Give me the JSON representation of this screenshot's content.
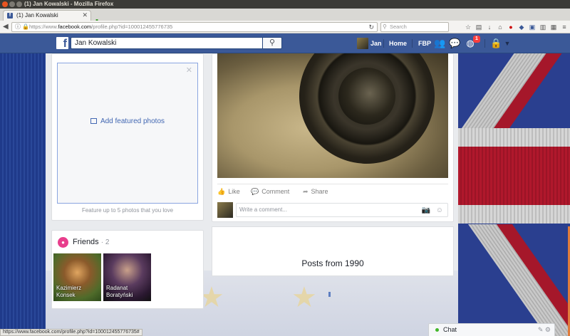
{
  "window": {
    "title": "(1) Jan Kowalski - Mozilla Firefox"
  },
  "browser": {
    "tab_label": "(1) Jan Kowalski",
    "url_prefix": "https://www.",
    "url_host": "facebook.com",
    "url_path": "/profile.php?id=100012455776735",
    "search_placeholder": "Search",
    "status_url": "https://www.facebook.com/profile.php?id=100012455776735#"
  },
  "fb_header": {
    "search_value": "Jan Kowalski",
    "profile_name": "Jan",
    "home_label": "Home",
    "page_label": "FBP",
    "notification_count": "1"
  },
  "featured": {
    "add_label": "Add featured photos",
    "caption": "Feature up to 5 photos that you love"
  },
  "friends": {
    "title": "Friends",
    "count": "· 2",
    "items": [
      {
        "first": "Kazimierz",
        "last": "Konsek"
      },
      {
        "first": "Radanat",
        "last": "Boratyński"
      }
    ]
  },
  "post": {
    "like_label": "Like",
    "comment_label": "Comment",
    "share_label": "Share",
    "comment_placeholder": "Write a comment..."
  },
  "timeline": {
    "posts_from": "Posts from 1990"
  },
  "chat": {
    "label": "Chat"
  },
  "colors": {
    "fb_blue": "#3b5998",
    "link_blue": "#4267b2",
    "notif_red": "#fa3e3e",
    "online_green": "#42b72a"
  }
}
